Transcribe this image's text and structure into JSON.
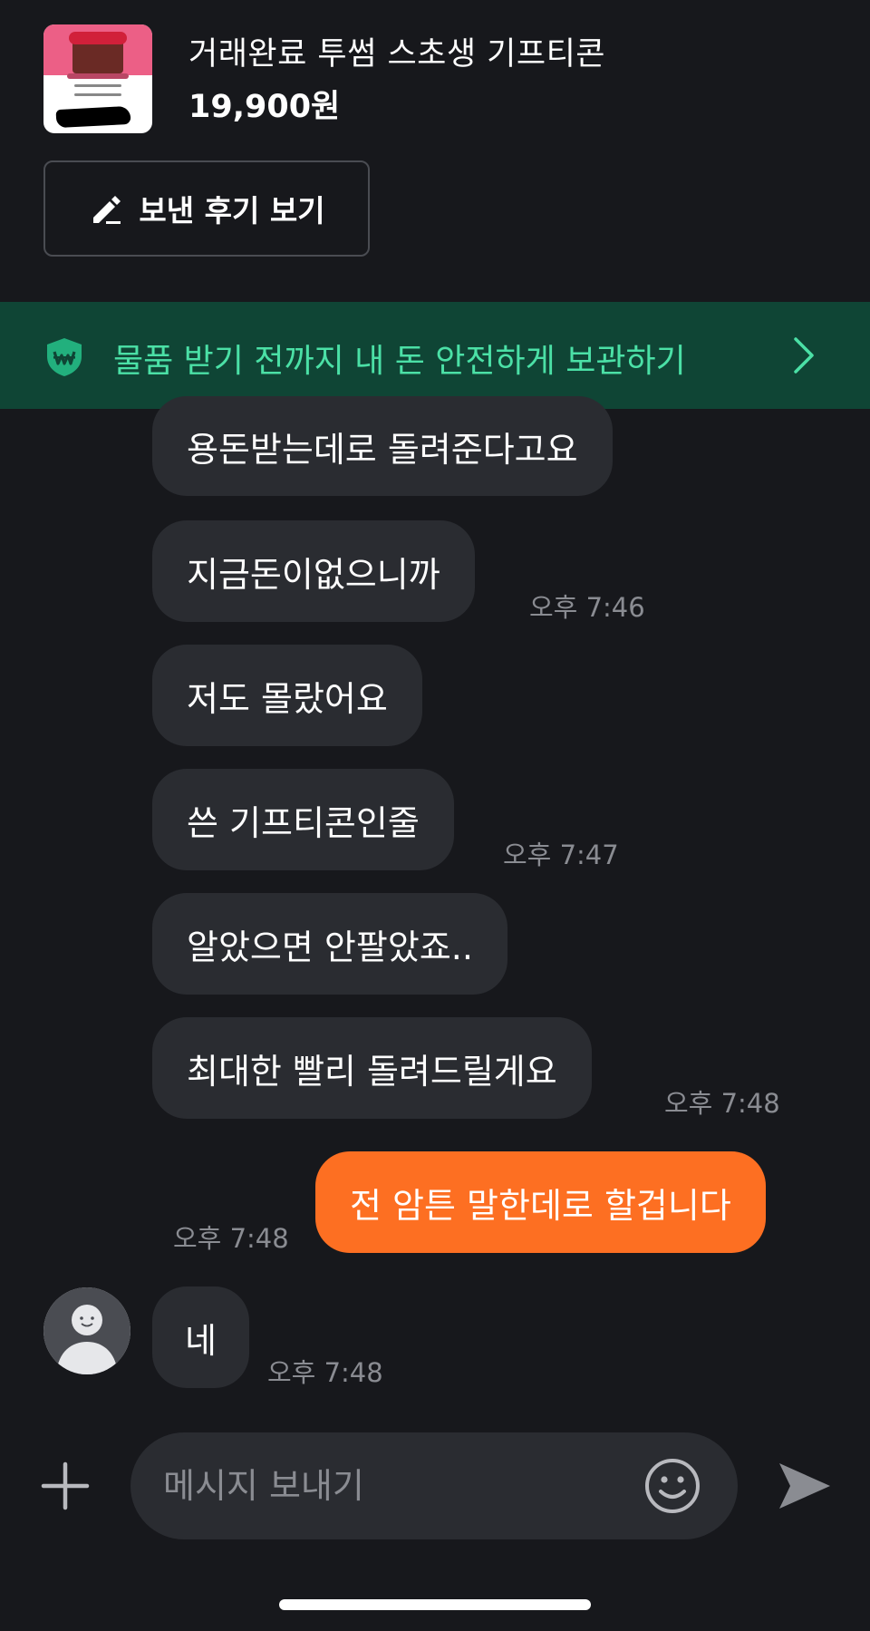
{
  "product": {
    "title": "거래완료 투썸 스초생 기프티콘",
    "price": "19,900원"
  },
  "review_button": {
    "label": "보낸 후기 보기",
    "icon": "pencil-icon"
  },
  "safe_banner": {
    "text": "물품 받기 전까지 내 돈 안전하게 보관하기",
    "icon": "won-shield-icon",
    "accent": "#4be0a6",
    "background": "#0f4535"
  },
  "messages": [
    {
      "text": "용돈받는데로 돌려준다고요",
      "time": ""
    },
    {
      "text": "지금돈이없으니까",
      "time": "오후 7:46"
    },
    {
      "text": "저도 몰랐어요",
      "time": ""
    },
    {
      "text": "쓴 기프티콘인줄",
      "time": "오후 7:47"
    },
    {
      "text": "알았으면 안팔았죠..",
      "time": ""
    },
    {
      "text": "최대한 빨리 돌려드릴게요",
      "time": "오후 7:48"
    },
    {
      "text": "전 암튼 말한데로 할겁니다",
      "time": "오후 7:48"
    },
    {
      "text": "네",
      "time": "오후 7:48"
    }
  ],
  "composer": {
    "placeholder": "메시지 보내기",
    "plus_icon": "plus-icon",
    "emoji_icon": "smiley-icon",
    "send_icon": "send-icon"
  },
  "colors": {
    "background": "#17181c",
    "bubble_other": "#2a2c31",
    "bubble_mine": "#fd6f22"
  }
}
